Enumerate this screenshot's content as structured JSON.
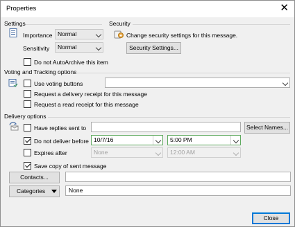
{
  "window": {
    "title": "Properties",
    "close_glyph": "✕"
  },
  "settings": {
    "section_label": "Settings",
    "importance_label": "Importance",
    "importance_value": "Normal",
    "sensitivity_label": "Sensitivity",
    "sensitivity_value": "Normal",
    "do_not_autoarchive_label": "Do not AutoArchive this item"
  },
  "security": {
    "section_label": "Security",
    "description": "Change security settings for this message.",
    "button_label": "Security Settings..."
  },
  "voting": {
    "section_label": "Voting and Tracking options",
    "use_voting_label": "Use voting buttons",
    "voting_value": "",
    "delivery_receipt_label": "Request a delivery receipt for this message",
    "read_receipt_label": "Request a read receipt for this message"
  },
  "delivery": {
    "section_label": "Delivery options",
    "have_replies_label": "Have replies sent to",
    "have_replies_value": "",
    "select_names_label": "Select Names...",
    "do_not_deliver_label": "Do not deliver before",
    "deliver_date": "10/7/16",
    "deliver_time": "5:00 PM",
    "expires_label": "Expires after",
    "expires_date": "None",
    "expires_time": "12:00 AM",
    "save_copy_label": "Save copy of sent message"
  },
  "contacts": {
    "button_label": "Contacts...",
    "value": ""
  },
  "categories": {
    "button_label": "Categories",
    "value": "None"
  },
  "footer": {
    "close_label": "Close"
  }
}
